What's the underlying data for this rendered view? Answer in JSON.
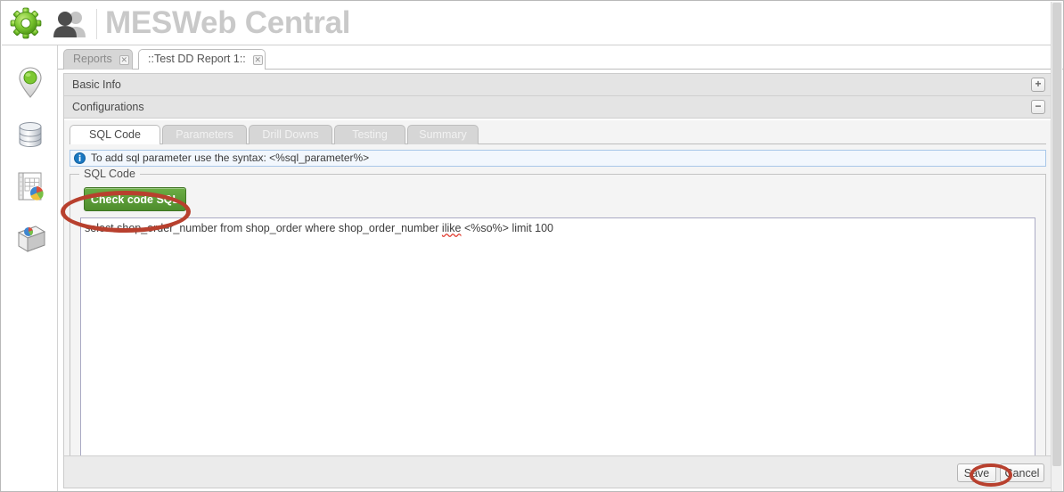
{
  "header": {
    "title": "MESWeb Central",
    "gear_icon": "gear-icon",
    "people_icon": "people-group-icon"
  },
  "sidebar": {
    "items": [
      {
        "icon": "map-pin-icon",
        "name": "sidebar-item-locations"
      },
      {
        "icon": "database-icon",
        "name": "sidebar-item-datasources"
      },
      {
        "icon": "report-chart-icon",
        "name": "sidebar-item-reports"
      },
      {
        "icon": "report-stack-icon",
        "name": "sidebar-item-report-library"
      }
    ]
  },
  "doc_tabs": [
    {
      "label": "Reports",
      "active": false,
      "close_icon": "close-icon"
    },
    {
      "label": "::Test DD Report 1::",
      "active": true,
      "close_icon": "close-icon"
    }
  ],
  "panels": [
    {
      "label": "Basic Info",
      "toggle": "+",
      "toggle_icon": "plus-icon",
      "expanded": false
    },
    {
      "label": "Configurations",
      "toggle": "−",
      "toggle_icon": "minus-icon",
      "expanded": true
    }
  ],
  "inner_tabs": [
    {
      "label": "SQL Code",
      "active": true
    },
    {
      "label": "Parameters",
      "active": false
    },
    {
      "label": "Drill Downs",
      "active": false
    },
    {
      "label": "Testing",
      "active": false
    },
    {
      "label": "Summary",
      "active": false
    }
  ],
  "info_bar": {
    "icon": "info-icon",
    "text": "To add sql parameter use the syntax: <%sql_parameter%>"
  },
  "sql_section": {
    "legend": "SQL Code",
    "check_button_label": "Check code SQL",
    "sql_prefix": "select shop_order_number from shop_order where shop_order_number ",
    "sql_misspelled": "ilike",
    "sql_suffix": " <%so%> limit 100",
    "sql_full": "select shop_order_number from shop_order where shop_order_number ilike <%so%> limit 100"
  },
  "footer": {
    "save_label": "Save",
    "cancel_label": "Cancel"
  },
  "colors": {
    "title_gray": "#c9c9c9",
    "green_button": "#4e8d2d",
    "annotation_red": "#b8402e",
    "info_blue": "#1a78c2",
    "panel_gray": "#e4e4e4"
  }
}
